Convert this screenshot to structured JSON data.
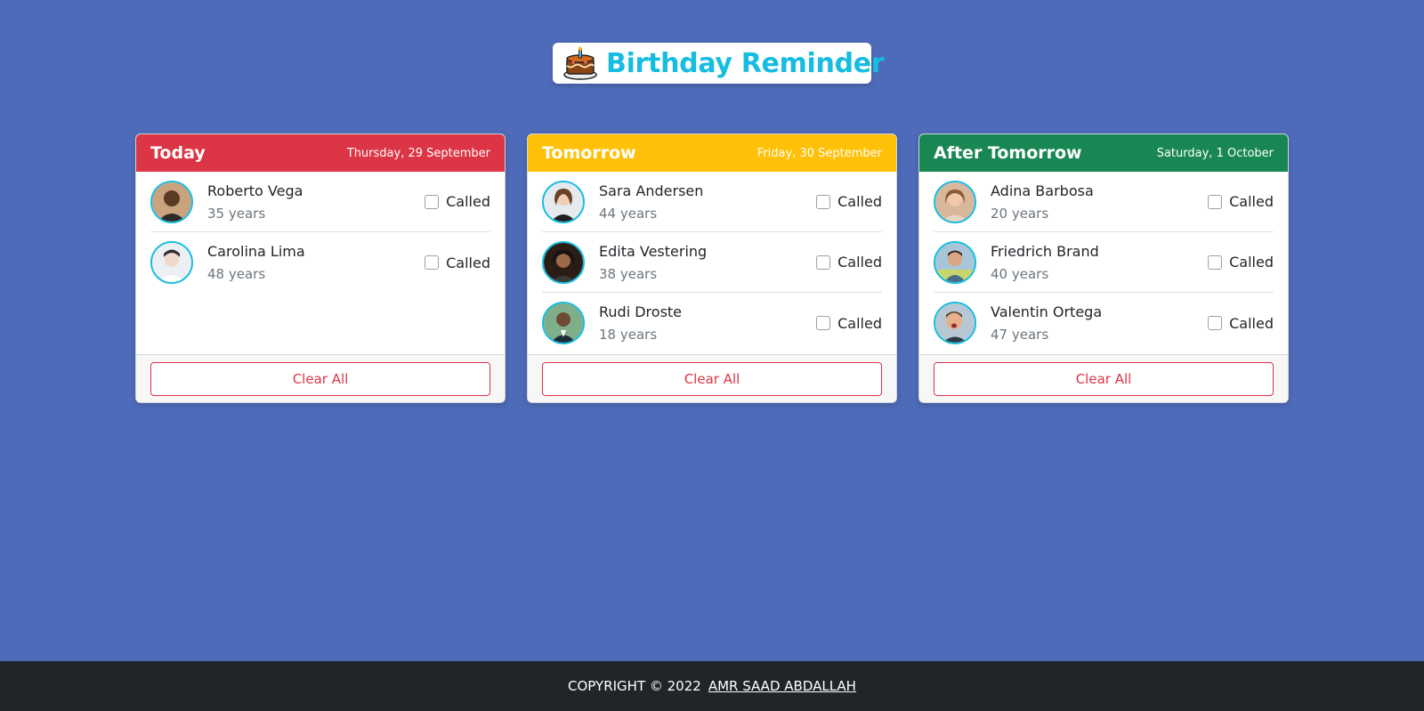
{
  "app": {
    "title": "Birthday Reminder",
    "title_icon": "birthday-cake-icon"
  },
  "colors": {
    "background": "#4e6bb9",
    "accent": "#16bde0",
    "today": "#dc3545",
    "tomorrow": "#ffc107",
    "after_tomorrow": "#198754",
    "footer": "#212529"
  },
  "columns": [
    {
      "title": "Today",
      "date": "Thursday, 29 September",
      "clear_label": "Clear All",
      "people": [
        {
          "name": "Roberto Vega",
          "age": "35 years",
          "check_label": "Called",
          "checked": false
        },
        {
          "name": "Carolina Lima",
          "age": "48 years",
          "check_label": "Called",
          "checked": false
        }
      ]
    },
    {
      "title": "Tomorrow",
      "date": "Friday, 30 September",
      "clear_label": "Clear All",
      "people": [
        {
          "name": "Sara Andersen",
          "age": "44 years",
          "check_label": "Called",
          "checked": false
        },
        {
          "name": "Edita Vestering",
          "age": "38 years",
          "check_label": "Called",
          "checked": false
        },
        {
          "name": "Rudi Droste",
          "age": "18 years",
          "check_label": "Called",
          "checked": false
        }
      ]
    },
    {
      "title": "After Tomorrow",
      "date": "Saturday, 1 October",
      "clear_label": "Clear All",
      "people": [
        {
          "name": "Adina Barbosa",
          "age": "20 years",
          "check_label": "Called",
          "checked": false
        },
        {
          "name": "Friedrich Brand",
          "age": "40 years",
          "check_label": "Called",
          "checked": false
        },
        {
          "name": "Valentin Ortega",
          "age": "47 years",
          "check_label": "Called",
          "checked": false
        }
      ]
    }
  ],
  "footer": {
    "copyright": "COPYRIGHT © 2022",
    "author": "AMR SAAD ABDALLAH"
  }
}
